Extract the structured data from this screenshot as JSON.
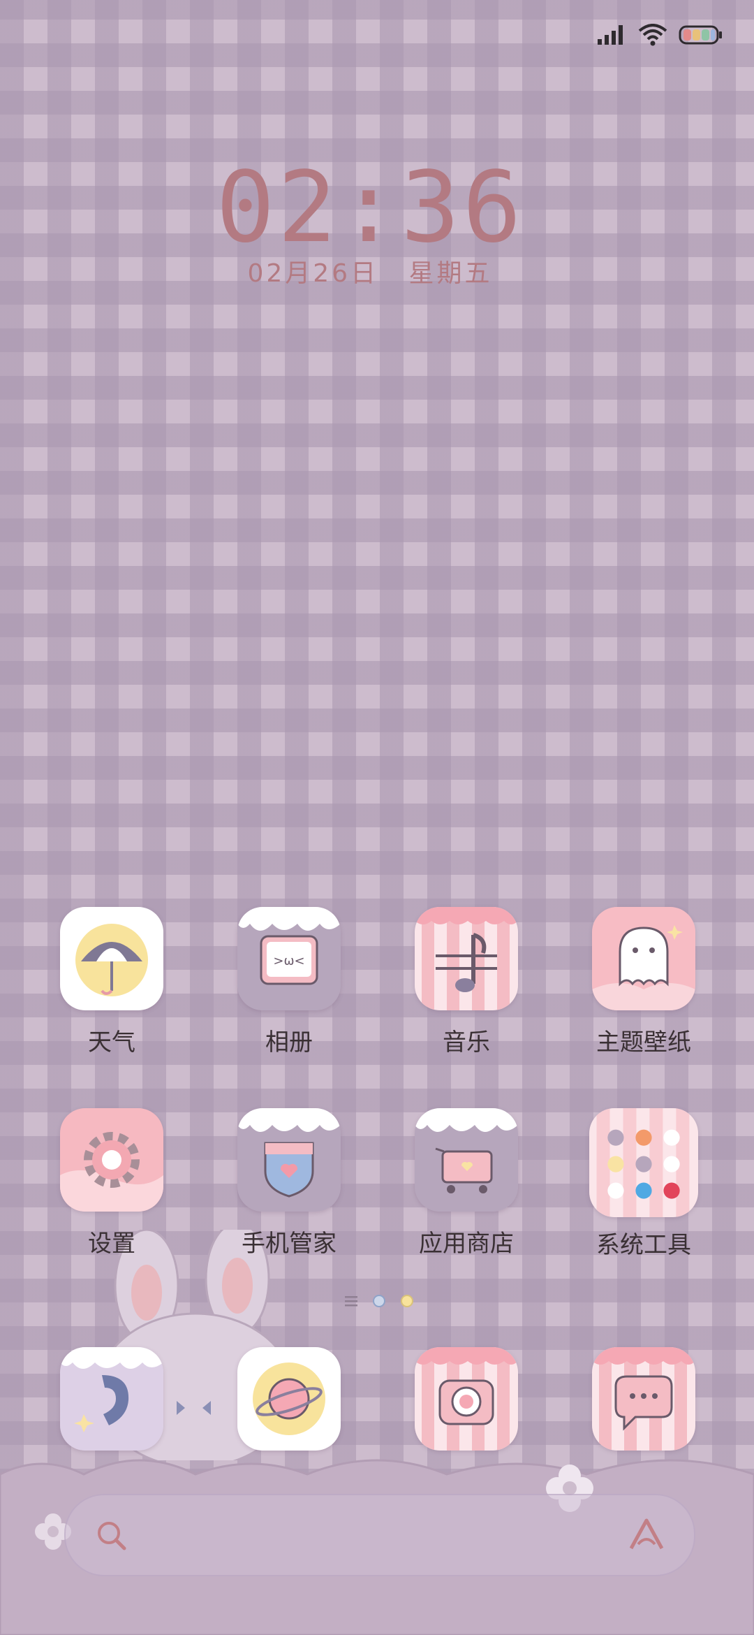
{
  "status_bar": {
    "signal_icon": "signal-bars-icon",
    "wifi_icon": "wifi-icon",
    "battery_icon": "battery-icon"
  },
  "clock": {
    "time": "02:36",
    "date": "02月26日",
    "weekday": "星期五"
  },
  "apps": [
    {
      "label": "天气",
      "icon": "weather-umbrella-icon"
    },
    {
      "label": "相册",
      "icon": "gallery-tv-cat-icon"
    },
    {
      "label": "音乐",
      "icon": "music-note-icon"
    },
    {
      "label": "主题壁纸",
      "icon": "themes-ghost-icon"
    },
    {
      "label": "设置",
      "icon": "settings-gear-icon"
    },
    {
      "label": "手机管家",
      "icon": "security-shield-icon"
    },
    {
      "label": "应用商店",
      "icon": "app-store-cart-icon"
    },
    {
      "label": "系统工具",
      "icon": "system-tools-folder-icon"
    }
  ],
  "dock": [
    {
      "icon": "phone-icon"
    },
    {
      "icon": "browser-planet-icon"
    },
    {
      "icon": "camera-icon"
    },
    {
      "icon": "messages-bubble-icon"
    }
  ],
  "page_indicator": {
    "pages": 3,
    "active": 2
  },
  "search_bar": {
    "search_icon": "search-icon",
    "assistant_icon": "assistant-a-icon"
  },
  "colors": {
    "clock": "#b37a82",
    "label": "#3a3034",
    "accent_pink": "#f4bcc4",
    "lavender": "#cdbccd"
  }
}
